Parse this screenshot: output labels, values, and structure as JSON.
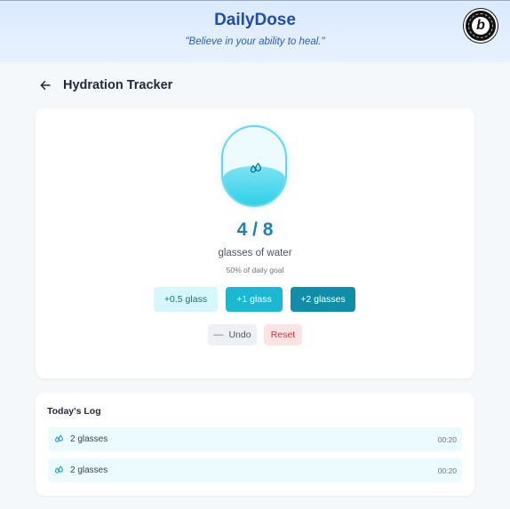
{
  "header": {
    "app_name": "DailyDose",
    "tagline": "\"Believe in your ability to heal.\"",
    "badge_letter": "b"
  },
  "page": {
    "title": "Hydration Tracker"
  },
  "tracker": {
    "count_text": "4 / 8",
    "consumed": 4,
    "goal": 8,
    "unit_label": "glasses of water",
    "goal_percent_text": "50% of daily goal",
    "fill_fraction": 0.5,
    "accent_color": "#1ab8d2",
    "icon": "droplets-icon"
  },
  "actions": {
    "add_half": "+0.5 glass",
    "add_one": "+1 glass",
    "add_two": "+2 glasses",
    "undo": "Undo",
    "reset": "Reset"
  },
  "log": {
    "title": "Today's Log",
    "entries": [
      {
        "amount": "2 glasses",
        "time": "00:20"
      },
      {
        "amount": "2 glasses",
        "time": "00:20"
      }
    ]
  }
}
